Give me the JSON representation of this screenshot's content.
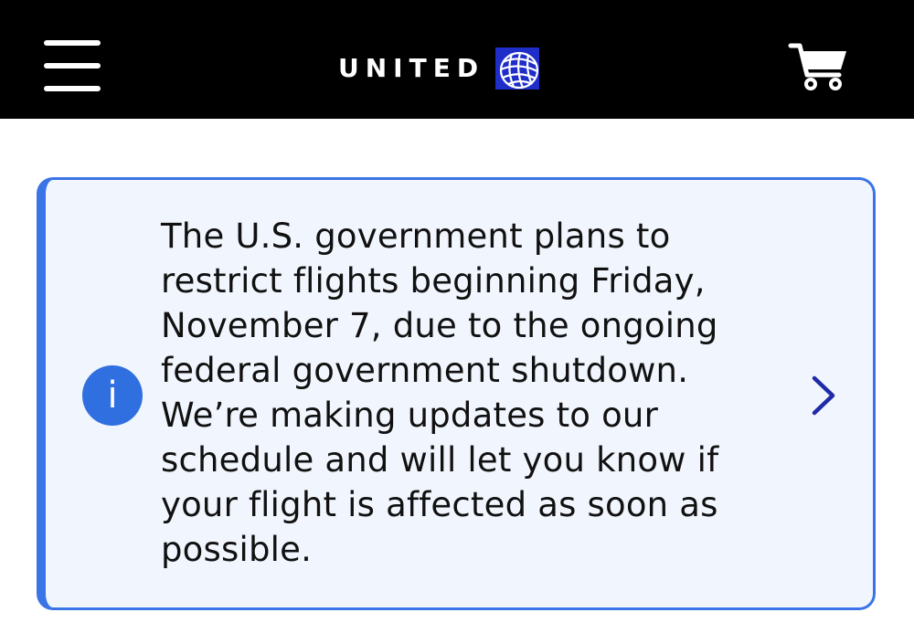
{
  "header": {
    "logo_text": "UNITED",
    "menu_icon": "hamburger-menu-icon",
    "cart_icon": "shopping-cart-icon",
    "background": "#000000"
  },
  "alert": {
    "icon": "info-icon",
    "icon_glyph": "i",
    "message": "The U.S. government plans to restrict flights beginning Friday, November 7, due to the ongoing federal government shutdown. We’re making updates to our schedule and will let you know if your flight is affected as soon as possible.",
    "chevron_icon": "chevron-right-icon",
    "accent_color": "#3a74e6",
    "background": "#f1f5fd",
    "chevron_color": "#1f2aa8"
  }
}
